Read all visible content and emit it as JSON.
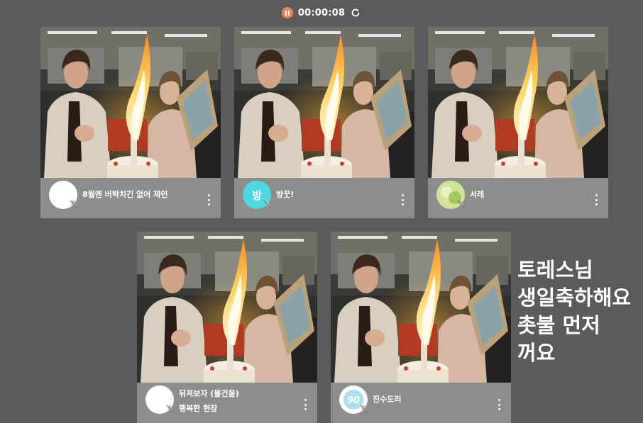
{
  "topbar": {
    "timer": "00:00:08",
    "pause_icon": "pause-icon",
    "refresh_icon": "refresh-icon",
    "accent": "#e8855a"
  },
  "participants": [
    {
      "name": "8월엔 버락치긴 없어 제인",
      "status": "",
      "avatar_text": "",
      "avatar_color": "#ffffff"
    },
    {
      "name": "방꿋!",
      "status": "",
      "avatar_text": "방",
      "avatar_color": "#4fd8e0"
    },
    {
      "name": "서레",
      "status": "",
      "avatar_text": "",
      "avatar_color": "#b9d97a"
    },
    {
      "name": "뒤져보자 (몰건울)",
      "status": "행복한 현장",
      "avatar_text": "",
      "avatar_color": "#ffffff"
    },
    {
      "name": "진수도리",
      "status": "",
      "avatar_text": "90",
      "avatar_color": "#a9dff0"
    }
  ],
  "overlay_message": [
    "토레스님",
    "생일축하해요",
    "촛불 먼저",
    "꺼요"
  ]
}
